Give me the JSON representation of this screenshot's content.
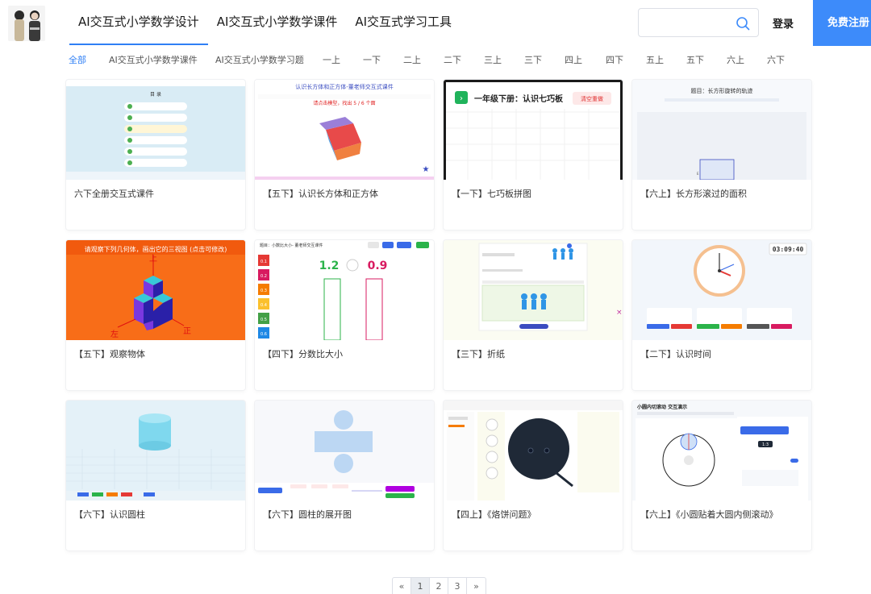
{
  "header": {
    "nav": [
      {
        "label": "AI交互式小学数学设计",
        "active": true
      },
      {
        "label": "AI交互式小学数学课件",
        "active": false
      },
      {
        "label": "AI交互式学习工具",
        "active": false
      }
    ],
    "search_placeholder": "",
    "login": "登录",
    "register": "免费注册"
  },
  "categories": [
    "全部",
    "AI交互式小学数学课件",
    "AI交互式小学数学习题",
    "一上",
    "一下",
    "二上",
    "二下",
    "三上",
    "三下",
    "四上",
    "四下",
    "五上",
    "五下",
    "六上",
    "六下"
  ],
  "cards": [
    {
      "title": "六下全册交互式课件",
      "thumb": {
        "heading": "目 录"
      }
    },
    {
      "title": "【五下】认识长方体和正方体",
      "thumb": {
        "heading": "认识长方体和正方体-董老师交互式课件",
        "prompt": "请点击模型，找出 5 / 6 个面"
      }
    },
    {
      "title": "【一下】七巧板拼图",
      "thumb": {
        "heading": "一年级下册：认识七巧板",
        "button": "清空重做"
      }
    },
    {
      "title": "【六上】长方形滚过的面积",
      "thumb": {
        "heading": "题目：长方形旋转的轨迹"
      }
    },
    {
      "title": "【五下】观察物体",
      "thumb": {
        "heading": "请观察下列几何体，画出它的三视图 (点击可修改)",
        "mark_top": "上",
        "mark_left": "左",
        "mark_front": "正"
      }
    },
    {
      "title": "【四下】分数比大小",
      "thumb": {
        "heading": "题目：小数比大小- 董老师交互课件",
        "value_left": "1.2",
        "value_right": "0.9",
        "side_values": [
          "0.1",
          "0.2",
          "0.3",
          "0.4",
          "0.5",
          "0.6"
        ]
      }
    },
    {
      "title": "【三下】折纸",
      "thumb": {}
    },
    {
      "title": "【二下】认识时间",
      "thumb": {
        "clock": "03:09:40"
      }
    },
    {
      "title": "【六下】认识圆柱",
      "thumb": {}
    },
    {
      "title": "【六下】圆柱的展开图",
      "thumb": {}
    },
    {
      "title": "【四上】《烙饼问题》",
      "thumb": {}
    },
    {
      "title": "【六上】《小圆贴着大圆内侧滚动》",
      "thumb": {
        "heading": "小圆内切滚动 交互演示",
        "value": "1:3"
      }
    }
  ],
  "pagination": {
    "prev": "«",
    "pages": [
      "1",
      "2",
      "3"
    ],
    "current": "1",
    "next": "»"
  },
  "colors": {
    "accent": "#2f7ff5",
    "register_bg": "#3d8bfa"
  }
}
